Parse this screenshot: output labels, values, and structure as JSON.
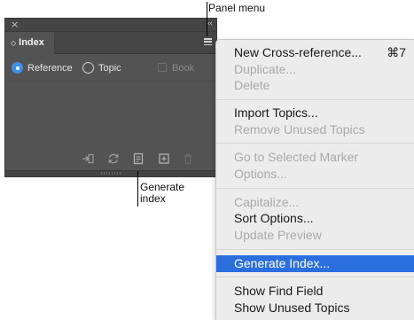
{
  "panel": {
    "close_glyph": "×",
    "collapse_glyph": "‹‹",
    "tab_glyph": "◇",
    "tab_label": "Index",
    "options": {
      "reference": "Reference",
      "topic": "Topic",
      "book": "Book",
      "selected": "reference"
    },
    "toolbar_icons": [
      "go-to-marker-icon",
      "refresh-icon",
      "generate-index-icon",
      "new-entry-icon",
      "trash-icon"
    ]
  },
  "callouts": {
    "panel_menu": "Panel menu",
    "generate_index_line1": "Generate",
    "generate_index_line2": "index"
  },
  "menu": {
    "items": [
      {
        "label": "New Cross-reference...",
        "shortcut": "⌘7",
        "enabled": true
      },
      {
        "label": "Duplicate...",
        "enabled": false
      },
      {
        "label": "Delete",
        "enabled": false
      },
      {
        "label": "Import Topics...",
        "enabled": true
      },
      {
        "label": "Remove Unused Topics",
        "enabled": false
      },
      {
        "label": "Go to Selected Marker",
        "enabled": false
      },
      {
        "label": "Options...",
        "enabled": false
      },
      {
        "label": "Capitalize...",
        "enabled": false
      },
      {
        "label": "Sort Options...",
        "enabled": true
      },
      {
        "label": "Update Preview",
        "enabled": false
      },
      {
        "label": "Generate Index...",
        "enabled": true,
        "highlighted": true
      },
      {
        "label": "Show Find Field",
        "enabled": true
      },
      {
        "label": "Show Unused Topics",
        "enabled": true
      }
    ]
  },
  "colors": {
    "panel_bg": "#535353",
    "radio_accent": "#3d8fe9",
    "menu_bg": "#ececec",
    "menu_highlight": "#2a6fdd"
  }
}
